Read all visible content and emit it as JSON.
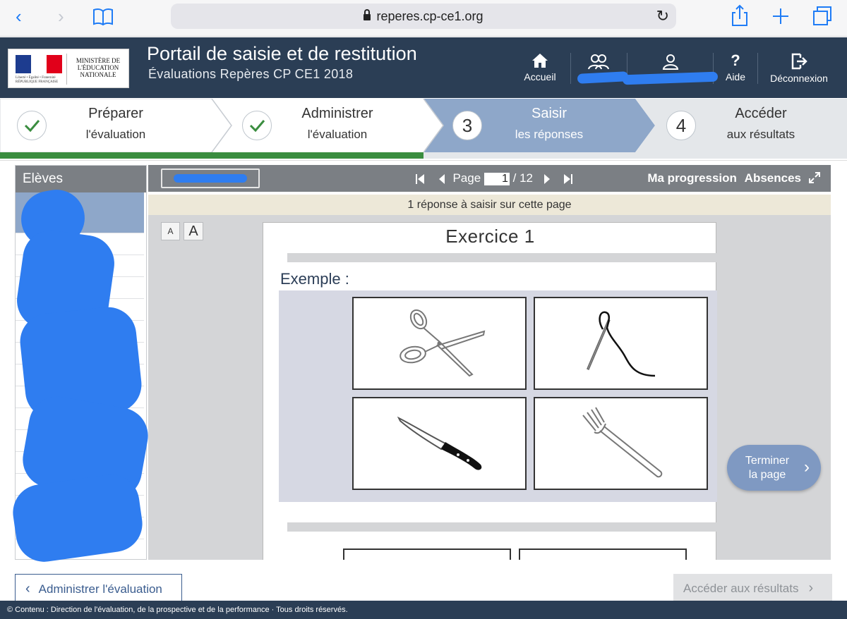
{
  "browser": {
    "url": "reperes.cp-ce1.org",
    "accent": "#1f7cf6"
  },
  "header": {
    "logo_text": "MINISTÈRE DE L'ÉDUCATION NATIONALE",
    "logo_motto": "Liberté • Égalité • Fraternité RÉPUBLIQUE FRANÇAISE",
    "title": "Portail de saisie et de restitution",
    "subtitle": "Évaluations Repères CP CE1 2018",
    "nav": {
      "home_label": "Accueil",
      "help_label": "Aide",
      "logout_label": "Déconnexion"
    },
    "bg_color": "#2b3e55"
  },
  "steps": [
    {
      "number": "1",
      "line1": "Préparer",
      "line2": "l'évaluation",
      "state": "done"
    },
    {
      "number": "2",
      "line1": "Administrer",
      "line2": "l'évaluation",
      "state": "done"
    },
    {
      "number": "3",
      "line1": "Saisir",
      "line2": "les réponses",
      "state": "active"
    },
    {
      "number": "4",
      "line1": "Accéder",
      "line2": "aux résultats",
      "state": "pending"
    }
  ],
  "progress_fraction": 0.5,
  "students_panel": {
    "title": "Elèves"
  },
  "toolbar": {
    "page_label": "Page",
    "page_current": "1",
    "page_total": "/ 12",
    "progress_label": "Ma progression",
    "absences_label": "Absences"
  },
  "banner_text": "1 réponse à saisir sur cette page",
  "font_buttons": {
    "small": "A",
    "large": "A"
  },
  "exercise": {
    "title": "Exercice 1",
    "example_label": "Exemple :",
    "images": [
      "scissors-icon",
      "needle-thread-icon",
      "knife-icon",
      "fork-icon"
    ]
  },
  "finish_button": {
    "line1": "Terminer",
    "line2": "la page"
  },
  "bottom_nav": {
    "back_label": "Administrer l'évaluation",
    "next_label": "Accéder aux résultats"
  },
  "footer_text": "© Contenu : Direction de l'évaluation, de la prospective et de la performance · Tous droits réservés."
}
